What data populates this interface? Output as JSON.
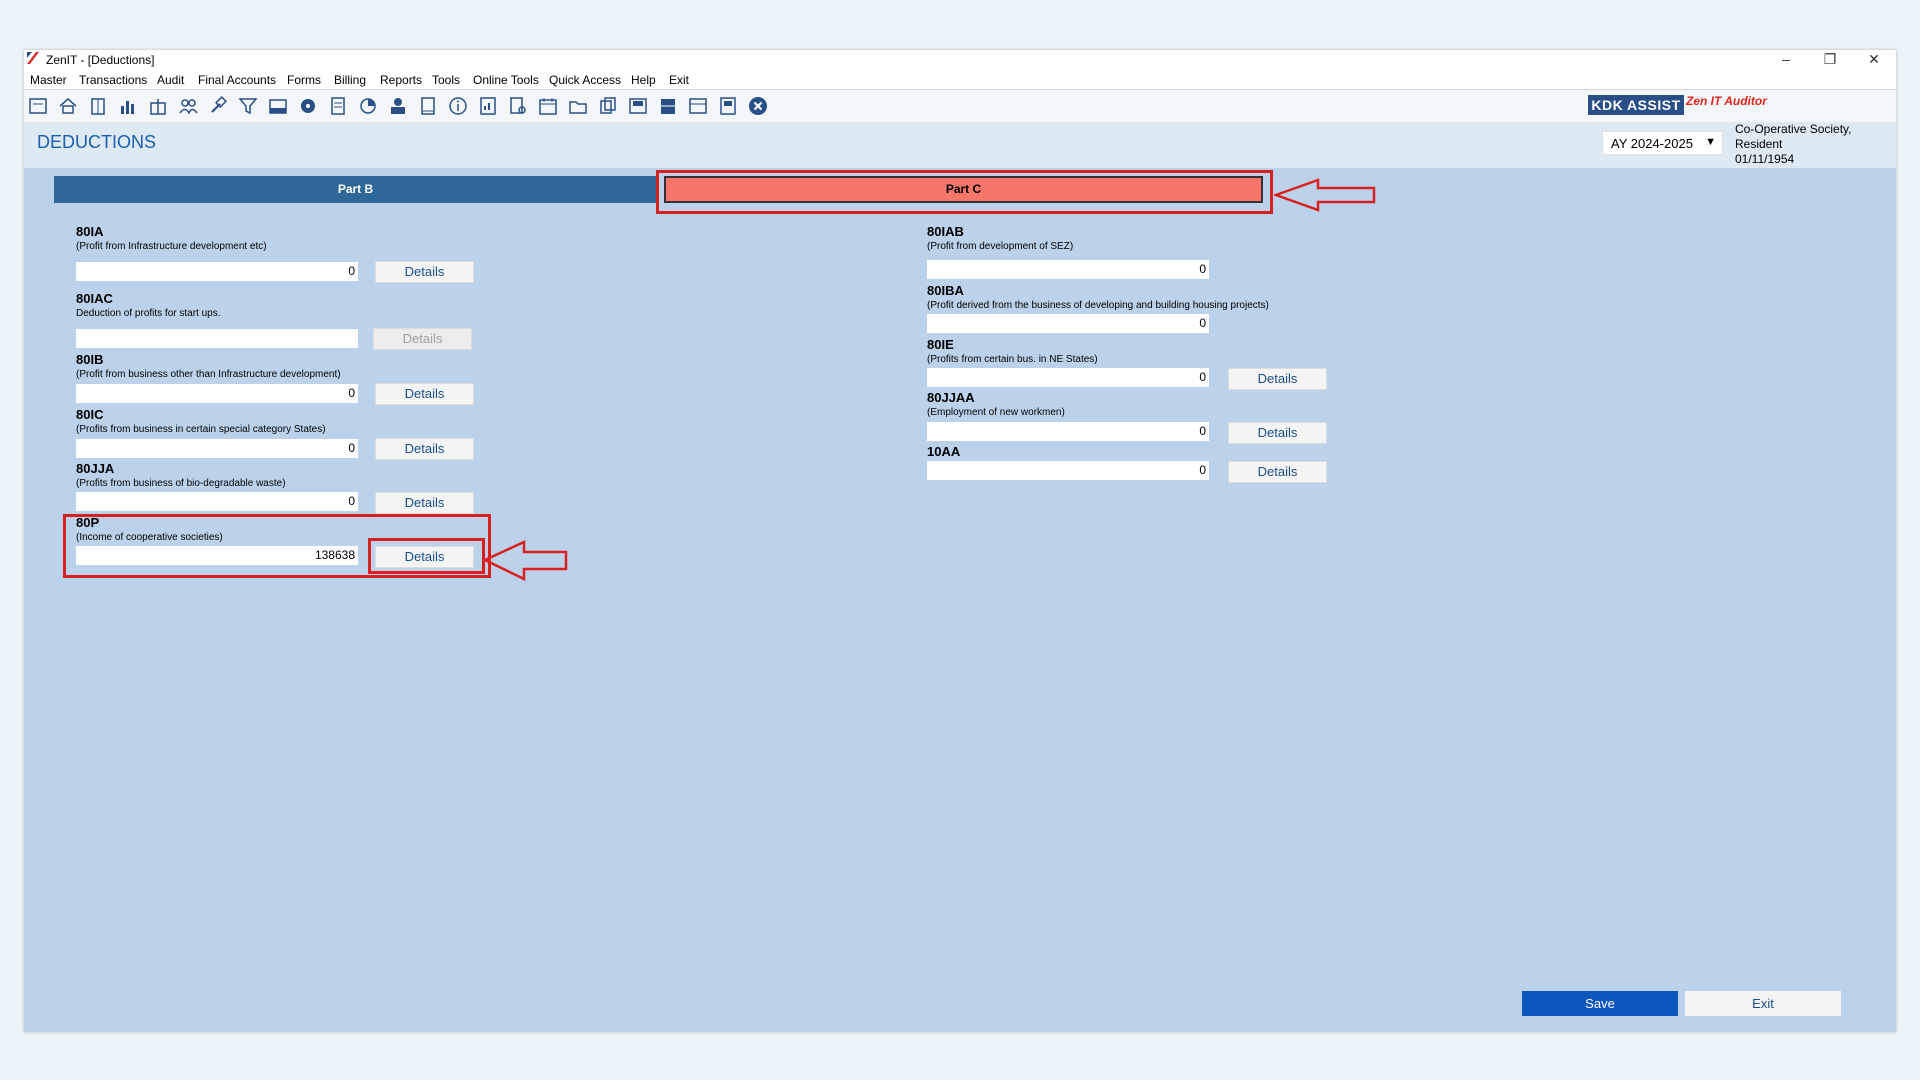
{
  "window": {
    "title": "ZenIT - [Deductions]",
    "controls": [
      "–",
      "❐",
      "✕"
    ]
  },
  "menu": [
    "Master",
    "Transactions",
    "Audit",
    "Final Accounts",
    "Forms",
    "Billing",
    "Reports",
    "Tools",
    "Online Tools",
    "Quick Access",
    "Help",
    "Exit"
  ],
  "brand": {
    "kdk": "KDK ASSIST",
    "product": "Zen IT Auditor"
  },
  "page": {
    "title": "DEDUCTIONS",
    "assessment_year": "AY 2024-2025",
    "assessee_status_1": "Co-Operative Society,",
    "assessee_status_2": "Resident",
    "assessee_date": "01/11/1954"
  },
  "tabs": {
    "part_b": "Part B",
    "part_c": "Part C",
    "active": "Part C"
  },
  "details_label": "Details",
  "left": [
    {
      "section": "80IA",
      "desc": "(Profit from Infrastructure development etc)",
      "value": "0"
    },
    {
      "section": "80IAC",
      "desc": "Deduction of profits for start ups.",
      "value": ""
    },
    {
      "section": "80IB",
      "desc": "(Profit from business other than Infrastructure development)",
      "value": "0"
    },
    {
      "section": "80IC",
      "desc": "(Profits from business in certain special category States)",
      "value": "0"
    },
    {
      "section": "80JJA",
      "desc": "(Profits from business of bio-degradable waste)",
      "value": "0"
    },
    {
      "section": "80P",
      "desc": "(Income of cooperative societies)",
      "value": "138638"
    }
  ],
  "right": [
    {
      "section": "80IAB",
      "desc": "(Profit from development of SEZ)",
      "value": "0"
    },
    {
      "section": "80IBA",
      "desc": "(Profit derived from the business of developing and building housing projects)",
      "value": "0"
    },
    {
      "section": "80IE",
      "desc": "(Profits from certain bus. in NE States)",
      "value": "0"
    },
    {
      "section": "80JJAA",
      "desc": "(Employment of new workmen)",
      "value": "0"
    },
    {
      "section": "10AA",
      "desc": "",
      "value": "0"
    }
  ],
  "buttons": {
    "save": "Save",
    "exit": "Exit"
  },
  "colors": {
    "accent": "#0d56c0",
    "tab_active": "#f6776a",
    "tab_inactive": "#2e6898",
    "highlight": "#d92020"
  }
}
